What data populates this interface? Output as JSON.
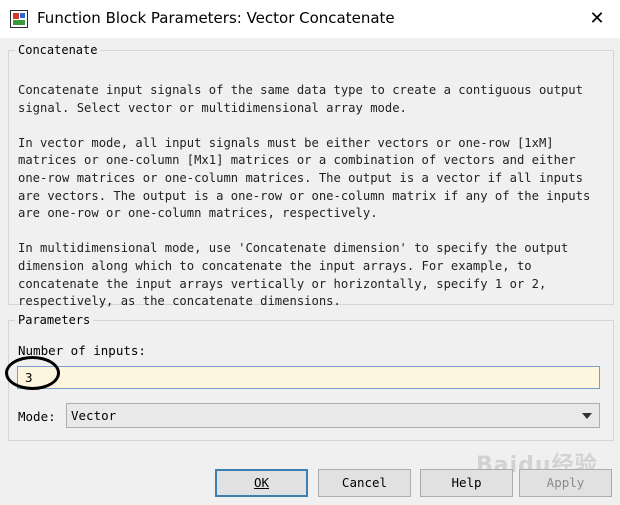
{
  "window": {
    "title": "Function Block Parameters: Vector Concatenate",
    "app_icon": "simulink-block-icon",
    "close_glyph": "✕"
  },
  "concatenate": {
    "legend": "Concatenate",
    "paragraphs": [
      "Concatenate input signals of the same data type to create a contiguous output signal. Select vector or multidimensional array mode.",
      "In vector mode, all input signals must be either vectors or one-row [1xM] matrices or one-column [Mx1] matrices or a combination of vectors and either one-row matrices or one-column matrices. The output is a vector if all inputs are vectors. The output is a one-row or one-column matrix if any of the inputs are one-row or one-column matrices, respectively.",
      "In multidimensional mode, use 'Concatenate dimension' to specify the output dimension along which to concatenate the input arrays. For example, to concatenate the input arrays vertically or horizontally, specify 1 or 2, respectively, as the concatenate dimensions."
    ]
  },
  "parameters": {
    "legend": "Parameters",
    "num_inputs_label": "Number of inputs:",
    "num_inputs_value": "3",
    "mode_label": "Mode:",
    "mode_value": "Vector"
  },
  "buttons": {
    "ok": "OK",
    "cancel": "Cancel",
    "help": "Help",
    "apply": "Apply"
  },
  "watermark": "Baidu经验",
  "colors": {
    "input_bg": "#fdf5dd",
    "ok_border": "#3c7fb1",
    "apply_disabled_text": "#8a8a8a"
  }
}
